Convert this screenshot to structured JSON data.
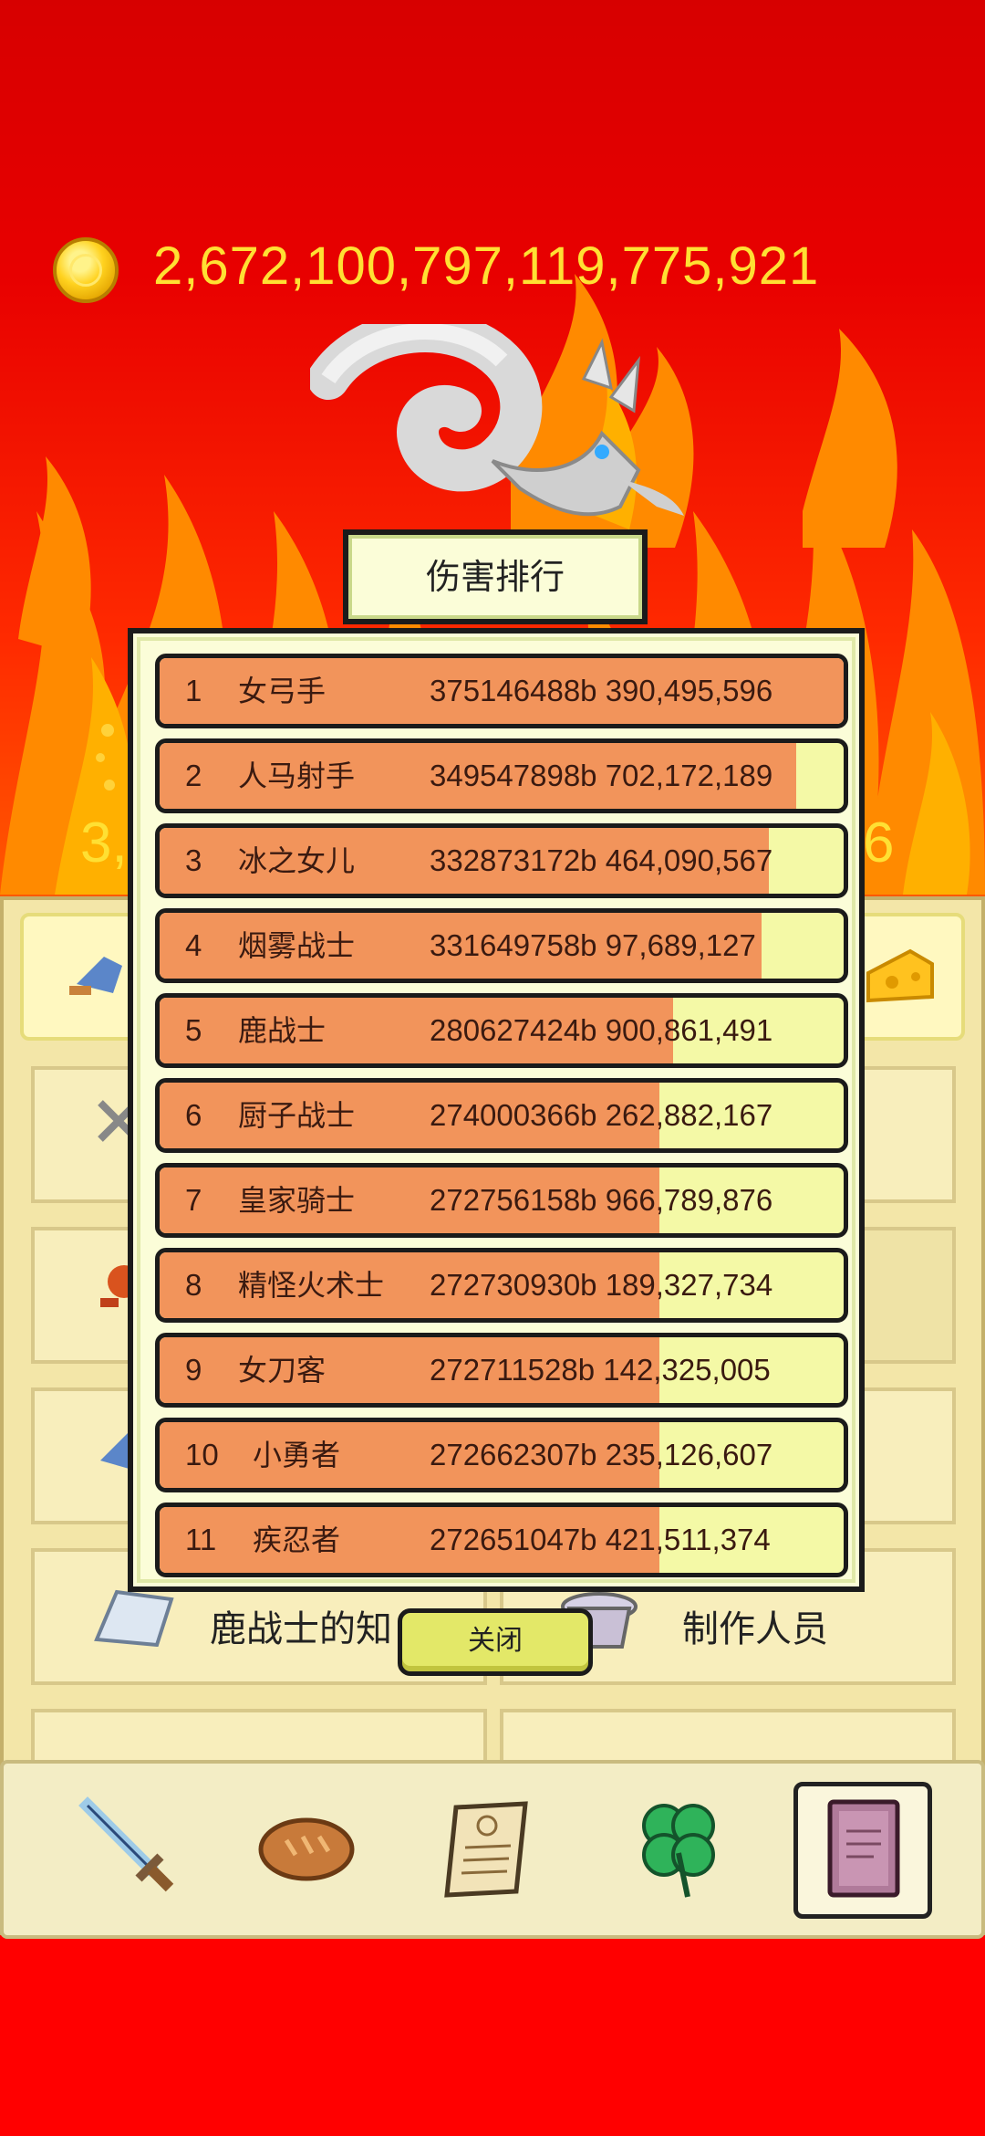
{
  "header": {
    "coins": "2,672,100,797,119,775,921",
    "hp_left_partial": "3,",
    "hp_right_partial": "6"
  },
  "dialog": {
    "title": "伤害排行",
    "close_label": "关闭",
    "rankings": [
      {
        "rank": "1",
        "name": "女弓手",
        "damage": "375146488b 390,495,596",
        "share": 1.0
      },
      {
        "rank": "2",
        "name": "人马射手",
        "damage": "349547898b 702,172,189",
        "share": 0.93
      },
      {
        "rank": "3",
        "name": "冰之女儿",
        "damage": "332873172b 464,090,567",
        "share": 0.89
      },
      {
        "rank": "4",
        "name": "烟雾战士",
        "damage": "331649758b 97,689,127",
        "share": 0.88
      },
      {
        "rank": "5",
        "name": "鹿战士",
        "damage": "280627424b 900,861,491",
        "share": 0.75
      },
      {
        "rank": "6",
        "name": "厨子战士",
        "damage": "274000366b 262,882,167",
        "share": 0.73
      },
      {
        "rank": "7",
        "name": "皇家骑士",
        "damage": "272756158b 966,789,876",
        "share": 0.73
      },
      {
        "rank": "8",
        "name": "精怪火术士",
        "damage": "272730930b 189,327,734",
        "share": 0.73
      },
      {
        "rank": "9",
        "name": "女刀客",
        "damage": "272711528b 142,325,005",
        "share": 0.73
      },
      {
        "rank": "10",
        "name": "小勇者",
        "damage": "272662307b 235,126,607",
        "share": 0.73
      },
      {
        "rank": "11",
        "name": "疾忍者",
        "damage": "272651047b 421,511,374",
        "share": 0.73
      }
    ]
  },
  "panel": {
    "knowledge_label": "鹿战士的知",
    "staff_label": "制作人员"
  },
  "nav": {
    "items": [
      "sword-icon",
      "bread-icon",
      "scroll-icon",
      "clover-icon",
      "book-icon"
    ],
    "selected": "book-icon"
  },
  "colors": {
    "background_red": "#ff0000",
    "coin_text": "#ffe033",
    "bar_fill": "#f2945b",
    "bar_track": "#f4f9a6",
    "dialog_bg": "#fbfdd8"
  }
}
